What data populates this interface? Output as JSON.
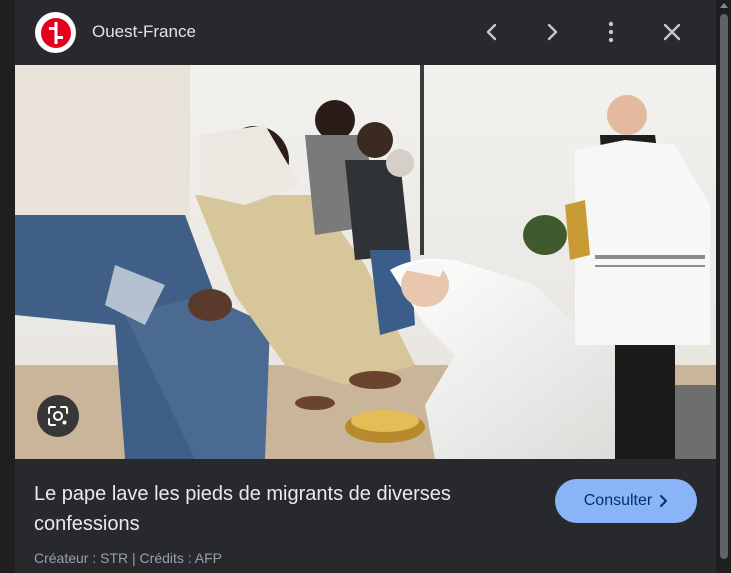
{
  "header": {
    "source_name": "Ouest-France",
    "logo_icon": "ouest-france-logo",
    "prev_icon": "chevron-left-icon",
    "next_icon": "chevron-right-icon",
    "more_icon": "more-vertical-icon",
    "close_icon": "close-icon"
  },
  "image": {
    "lens_icon": "google-lens-icon"
  },
  "details": {
    "title": "Le pape lave les pieds de migrants de diverses confessions",
    "consult_label": "Consulter",
    "consult_icon": "chevron-right-icon",
    "credits": "Créateur : STR | Crédits : AFP"
  },
  "colors": {
    "panel_bg": "#28292c",
    "button_bg": "#8ab4f8",
    "logo_red": "#e2001a"
  }
}
